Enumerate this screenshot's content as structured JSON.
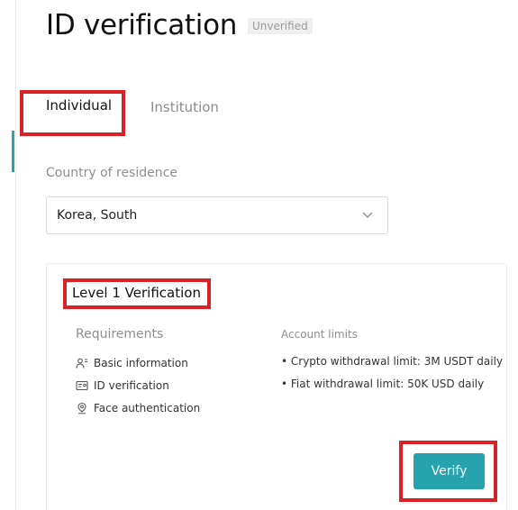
{
  "header": {
    "title": "ID verification",
    "status_badge": "Unverified"
  },
  "tabs": [
    {
      "label": "Individual",
      "active": true
    },
    {
      "label": "Institution",
      "active": false
    }
  ],
  "form": {
    "country_label": "Country of residence",
    "country_value": "Korea, South"
  },
  "level1": {
    "title": "Level 1 Verification",
    "requirements_heading": "Requirements",
    "requirements": [
      {
        "label": "Basic information",
        "icon": "user-info-icon"
      },
      {
        "label": "ID verification",
        "icon": "id-card-icon"
      },
      {
        "label": "Face authentication",
        "icon": "face-location-icon"
      }
    ],
    "limits_heading": "Account limits",
    "limits": [
      "• Crypto withdrawal limit: 3M USDT daily",
      "• Fiat withdrawal limit: 50K USD daily"
    ],
    "verify_label": "Verify"
  },
  "colors": {
    "accent": "#26a3ad",
    "highlight": "#d92127"
  }
}
